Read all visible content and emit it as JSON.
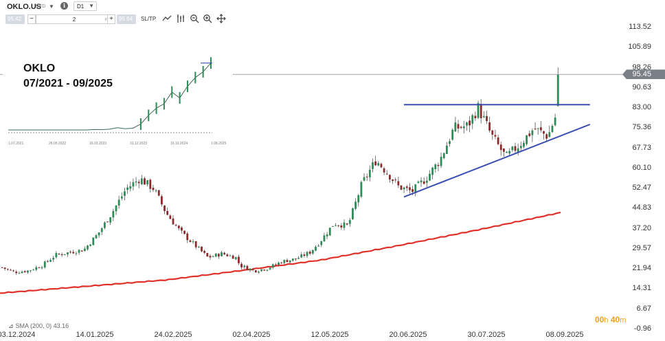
{
  "toolbar": {
    "symbol": "OKLO.US",
    "symbol_type": "CFD",
    "timeframe": "D1",
    "sell_price": "95.42",
    "buy_price": "95.64",
    "quantity": "2",
    "minus_label": "−",
    "plus_label": "+",
    "sltp_label": "SL/TP",
    "info_label": "i",
    "icons": [
      "line-draw-icon",
      "indicators-icon",
      "zoom-out-icon",
      "zoom-in-icon",
      "crosshair-icon"
    ]
  },
  "status": {
    "countdown_h": "00",
    "countdown_h_unit": "h",
    "countdown_m": "40",
    "countdown_m_unit": "m",
    "sma_label": "SMA (200, 0) 43.16",
    "current_price": "95.45"
  },
  "inset": {
    "title": "OKLO",
    "period": "07/2021 - 09/2025"
  },
  "colors": {
    "bull": "#2e8b57",
    "bear": "#8b2a2a",
    "sma": "#e0302a",
    "trendline": "#3a4fb0",
    "price_line": "#9aa0a6",
    "countdown": "#f0a020"
  },
  "chart_data": {
    "type": "candlestick",
    "symbol": "OKLO.US",
    "timeframe": "D1",
    "y_ticks": [
      113.52,
      105.89,
      98.26,
      90.63,
      83.0,
      75.36,
      67.73,
      60.1,
      52.47,
      44.83,
      37.2,
      29.57,
      21.94,
      14.31,
      6.67,
      -0.96
    ],
    "ylim": [
      -0.96,
      113.52
    ],
    "x_ticks": [
      "03.12.2024",
      "14.01.2025",
      "24.02.2025",
      "02.04.2025",
      "12.05.2025",
      "20.06.2025",
      "30.07.2025",
      "08.09.2025"
    ],
    "current_price": 95.45,
    "close_path": [
      [
        "2024-12-03",
        22.5
      ],
      [
        "2024-12-10",
        20.5
      ],
      [
        "2024-12-17",
        21.0
      ],
      [
        "2024-12-24",
        23.0
      ],
      [
        "2024-12-31",
        27.0
      ],
      [
        "2025-01-07",
        28.0
      ],
      [
        "2025-01-14",
        29.0
      ],
      [
        "2025-01-21",
        35.0
      ],
      [
        "2025-01-28",
        43.0
      ],
      [
        "2025-02-04",
        52.0
      ],
      [
        "2025-02-11",
        56.0
      ],
      [
        "2025-02-18",
        52.0
      ],
      [
        "2025-02-24",
        43.0
      ],
      [
        "2025-03-03",
        36.0
      ],
      [
        "2025-03-10",
        31.0
      ],
      [
        "2025-03-17",
        26.0
      ],
      [
        "2025-03-24",
        27.5
      ],
      [
        "2025-03-31",
        26.0
      ],
      [
        "2025-04-02",
        23.0
      ],
      [
        "2025-04-09",
        21.0
      ],
      [
        "2025-04-16",
        22.0
      ],
      [
        "2025-04-23",
        24.5
      ],
      [
        "2025-04-30",
        25.5
      ],
      [
        "2025-05-07",
        28.0
      ],
      [
        "2025-05-12",
        32.0
      ],
      [
        "2025-05-19",
        39.0
      ],
      [
        "2025-05-26",
        38.0
      ],
      [
        "2025-06-02",
        54.0
      ],
      [
        "2025-06-09",
        63.0
      ],
      [
        "2025-06-16",
        57.0
      ],
      [
        "2025-06-20",
        53.0
      ],
      [
        "2025-06-27",
        51.0
      ],
      [
        "2025-07-04",
        56.0
      ],
      [
        "2025-07-11",
        63.0
      ],
      [
        "2025-07-18",
        75.0
      ],
      [
        "2025-07-25",
        76.0
      ],
      [
        "2025-07-30",
        83.0
      ],
      [
        "2025-08-06",
        72.0
      ],
      [
        "2025-08-13",
        64.0
      ],
      [
        "2025-08-20",
        69.0
      ],
      [
        "2025-08-27",
        75.0
      ],
      [
        "2025-09-03",
        72.0
      ],
      [
        "2025-09-08",
        82.0
      ],
      [
        "2025-09-10",
        95.45
      ]
    ],
    "sma_200": [
      [
        "2024-12-03",
        12.5
      ],
      [
        "2025-02-24",
        17.5
      ],
      [
        "2025-04-02",
        21.0
      ],
      [
        "2025-05-12",
        25.0
      ],
      [
        "2025-06-20",
        30.5
      ],
      [
        "2025-07-30",
        36.5
      ],
      [
        "2025-09-10",
        43.16
      ]
    ],
    "trendlines": [
      {
        "name": "resistance",
        "from": [
          "2025-06-23",
          84.0
        ],
        "to": [
          "2025-09-24",
          84.0
        ]
      },
      {
        "name": "support",
        "from": [
          "2025-06-23",
          49.0
        ],
        "to": [
          "2025-09-24",
          76.5
        ]
      }
    ],
    "indicator": "SMA (200, 0) 43.16",
    "inset": {
      "title": "OKLO",
      "period": "07/2021 - 09/2025",
      "x_ticks": [
        "1.07.2021",
        "26.05.2022",
        "16.03.2023",
        "31.12.2023",
        "16.10.2024",
        "1.08.2025"
      ],
      "close_path": [
        0,
        0,
        0,
        0,
        0,
        0,
        0,
        0,
        0,
        0,
        0,
        0.3,
        0.2,
        0.5,
        1.5,
        0.8,
        1.2,
        4,
        10,
        15,
        18,
        26,
        22,
        30,
        36,
        40,
        46
      ]
    }
  }
}
